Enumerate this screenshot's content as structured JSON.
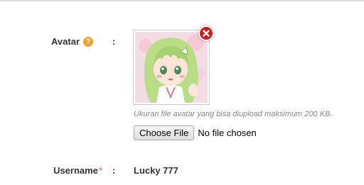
{
  "avatar": {
    "label": "Avatar",
    "help_icon": "help-icon",
    "help_symbol": "?",
    "colon": ":",
    "delete_icon": "close-icon",
    "hint": "Ukuran file avatar yang bisa diupload maksimum 200 KB.",
    "choose_file_label": "Choose File",
    "file_status": "No file chosen"
  },
  "username": {
    "label": "Username",
    "required_mark": "*",
    "colon": ":",
    "value": "Lucky 777"
  },
  "colors": {
    "help_icon": "#f0a030",
    "delete_button": "#c81e1e",
    "required_mark": "#d9534f",
    "hint_text": "#888888"
  }
}
